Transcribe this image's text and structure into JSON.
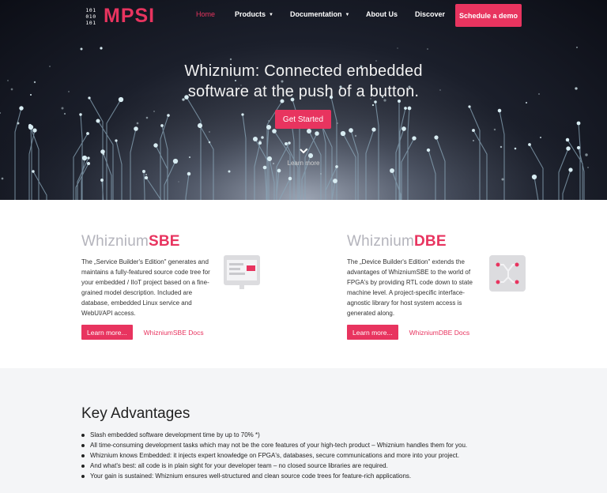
{
  "brand": {
    "logo_digits": [
      "101",
      "010",
      "101"
    ],
    "name": "MPSI",
    "accent_color": "#e8345f"
  },
  "nav": {
    "home": "Home",
    "products": "Products",
    "documentation": "Documentation",
    "about": "About Us",
    "discover": "Discover",
    "cta": "Schedule a demo"
  },
  "hero": {
    "title_line1": "Whiznium: Connected embedded",
    "title_line2": "software at the push of a button.",
    "button": "Get Started",
    "learn_more": "Learn more"
  },
  "products": [
    {
      "title_prefix": "Whiznium",
      "title_suffix": "SBE",
      "description": "The „Service Builder's Edition\" generates and maintains a fully-featured source code tree for your embedded / IIoT project based on a fine-grained model description. Included are database, embedded Linux service and WebUI/API access.",
      "button": "Learn more...",
      "docs_link": "WhizniumSBE Docs",
      "icon": "browser-window-icon"
    },
    {
      "title_prefix": "Whiznium",
      "title_suffix": "DBE",
      "description": "The „Device Builder's Edition\" extends the advantages of WhizniumSBE to the world of FPGA's by providing RTL code down to state machine level. A project-specific interface-agnostic library for host system access is generated along.",
      "button": "Learn more...",
      "docs_link": "WhizniumDBE Docs",
      "icon": "circuit-chip-icon"
    }
  ],
  "advantages": {
    "title": "Key Advantages",
    "items": [
      "Slash embedded software development time by up to 70% *)",
      "All time-consuming development tasks which may not be the core features of your high-tech product – Whiznium handles them for you.",
      "Whiznium knows Embedded: it injects expert knowledge on FPGA's, databases, secure communications and more into your project.",
      "And what's best: all code is in plain sight for your developer team – no closed source libraries are required.",
      "Your gain is sustained: Whiznium ensures well-structured and clean source code trees for feature-rich applications."
    ]
  }
}
